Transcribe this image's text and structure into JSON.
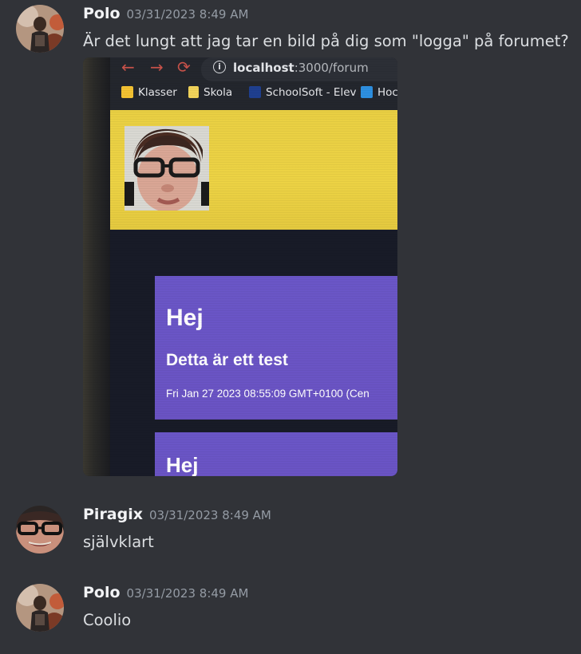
{
  "messages": [
    {
      "author": "Polo",
      "timestamp": "03/31/2023 8:49 AM",
      "text": "Är det lungt att jag tar en bild på dig som \"logga\" på forumet?",
      "attachment": {
        "url_host": "localhost",
        "url_path": ":3000/forum",
        "bookmarks": [
          "Klasser",
          "Skola",
          "SchoolSoft - Elev",
          "Hoc"
        ],
        "cards": [
          {
            "title": "Hej",
            "subtitle": "Detta är ett test",
            "date": "Fri Jan 27 2023 08:55:09 GMT+0100 (Cen"
          },
          {
            "title": "Hej"
          }
        ]
      }
    },
    {
      "author": "Piragix",
      "timestamp": "03/31/2023 8:49 AM",
      "text": "självklart"
    },
    {
      "author": "Polo",
      "timestamp": "03/31/2023 8:49 AM",
      "text": "Coolio"
    }
  ],
  "colors": {
    "background": "#313338",
    "author": "#f2f3f5",
    "timestamp": "#949ba4",
    "text": "#dbdee1",
    "header_yellow": "#e9cf43",
    "card_purple": "#6a56c7"
  },
  "icons": [
    "back-arrow-icon",
    "forward-arrow-icon",
    "reload-icon",
    "info-icon",
    "bookmark-icons"
  ]
}
